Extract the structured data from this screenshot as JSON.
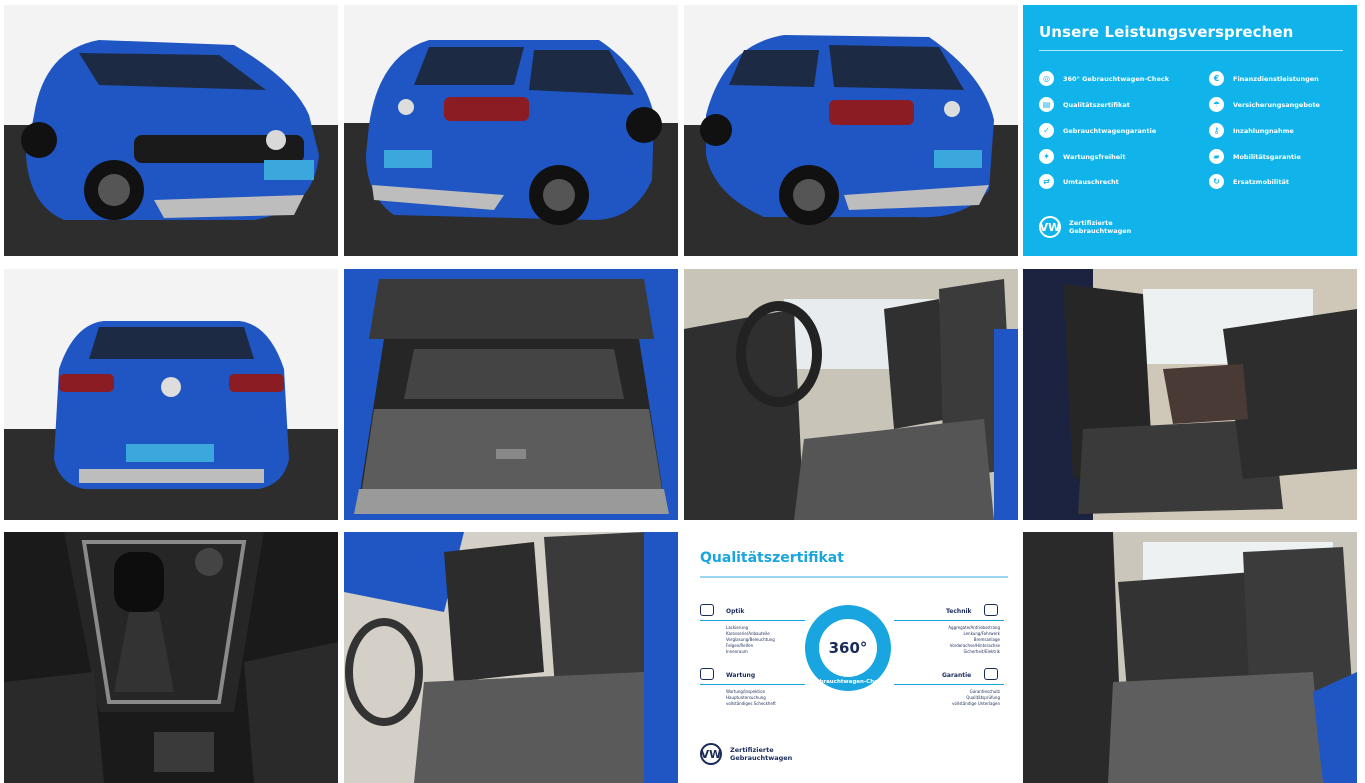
{
  "gallery": {
    "photos": [
      {
        "icon": "car-front-three-quarter-icon"
      },
      {
        "icon": "car-rear-three-quarter-icon"
      },
      {
        "icon": "car-rear-left-icon"
      },
      {
        "icon": "car-rear-icon"
      },
      {
        "icon": "trunk-icon"
      },
      {
        "icon": "front-seats-driver-side-icon"
      },
      {
        "icon": "front-seats-passenger-side-icon"
      },
      {
        "icon": "gear-shifter-icon"
      },
      {
        "icon": "front-seats-icon"
      },
      {
        "icon": "rear-seats-icon"
      }
    ]
  },
  "promise_card": {
    "title": "Unsere Leistungsversprechen",
    "left_items": [
      "360° Gebrauchtwagen-Check",
      "Qualitätszertifikat",
      "Gebrauchtwagengarantie",
      "Wartungsfreiheit",
      "Umtauschrecht"
    ],
    "right_items": [
      "Finanzdienstleistungen",
      "Versicherungsangebote",
      "Inzahlungnahme",
      "Mobilitätsgarantie",
      "Ersatzmobilität"
    ],
    "brand_line1": "Zertifizierte",
    "brand_line2": "Gebrauchtwagen",
    "brand_logo": "VW"
  },
  "certificate_card": {
    "title": "Qualitätszertifikat",
    "center_label": "360°",
    "ring_label": "Gebrauchtwagen-Check",
    "sections": {
      "optik": {
        "heading": "Optik",
        "items": [
          "Lackierung",
          "Karosserie/Anbauteile",
          "Verglasung/Beleuchtung",
          "Felgen/Reifen",
          "Innenraum"
        ]
      },
      "technik": {
        "heading": "Technik",
        "items": [
          "Aggregate/Antriebsstrang",
          "Lenkung/Fahrwerk",
          "Bremsanlage",
          "Vorderachse/Hinterachse",
          "Sicherheit/Elektrik"
        ]
      },
      "wartung": {
        "heading": "Wartung",
        "items": [
          "Wartung/Inspektion",
          "Hauptuntersuchung",
          "vollständiges Scheckheft"
        ]
      },
      "garantie": {
        "heading": "Garantie",
        "items": [
          "Garantieschutz",
          "Qualitätsprüfung",
          "vollständige Unterlagen"
        ]
      }
    },
    "brand_line1": "Zertifizierte",
    "brand_line2": "Gebrauchtwagen",
    "brand_logo": "VW"
  },
  "colors": {
    "vw_blue": "#10b4ea",
    "car_blue": "#1f56c3",
    "navy": "#1a2b5a"
  }
}
